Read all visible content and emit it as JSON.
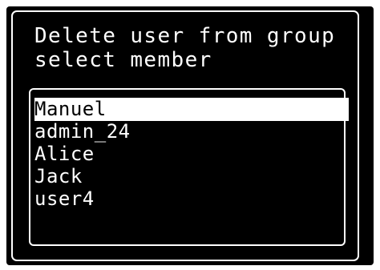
{
  "dialog": {
    "title": "Delete user from group",
    "subtitle": "select member"
  },
  "members": {
    "selected_index": 0,
    "items": [
      {
        "label": "Manuel"
      },
      {
        "label": "admin_24"
      },
      {
        "label": "Alice"
      },
      {
        "label": "Jack"
      },
      {
        "label": "user4"
      }
    ]
  },
  "colors": {
    "background": "#000000",
    "foreground": "#ffffff",
    "selection_background": "#ffffff",
    "selection_foreground": "#000000"
  }
}
